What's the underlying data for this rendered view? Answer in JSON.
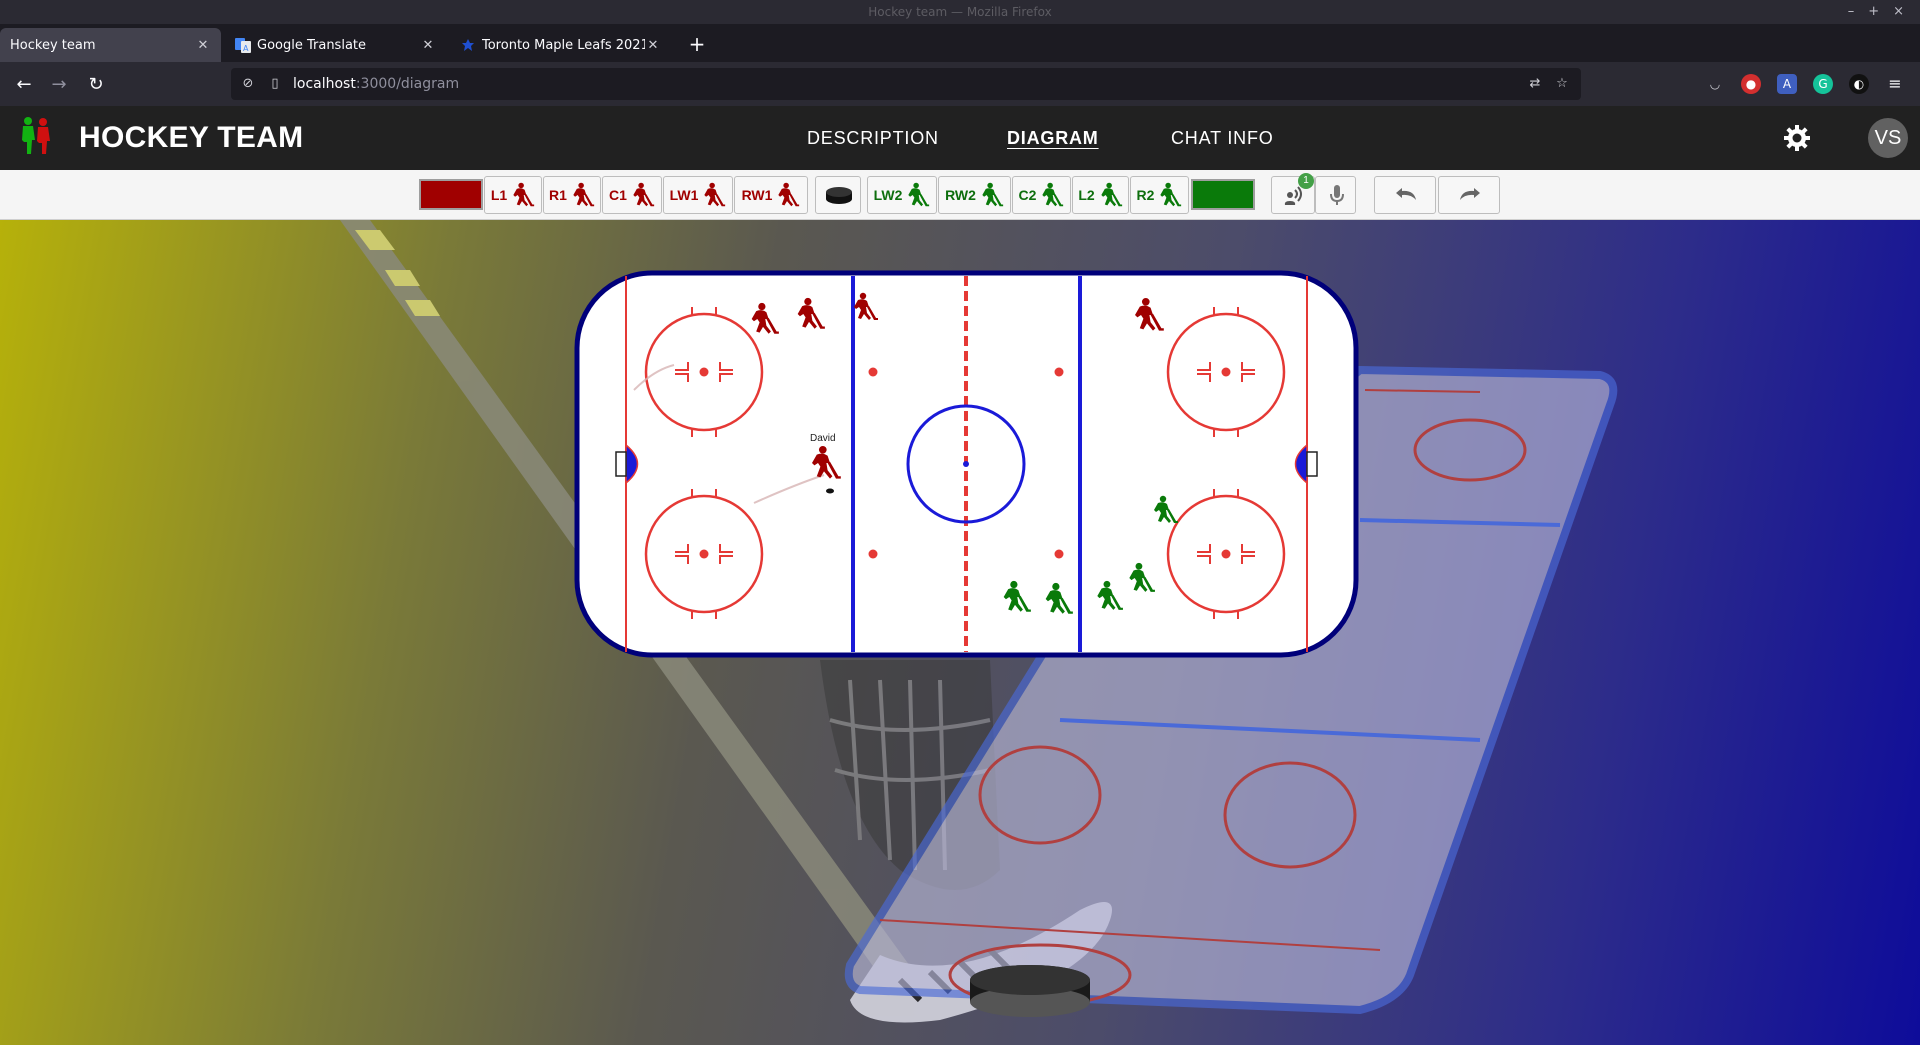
{
  "window": {
    "title": "Hockey team — Mozilla Firefox",
    "controls": [
      "–",
      "+",
      "×"
    ]
  },
  "tabs": [
    {
      "label": "Hockey team",
      "active": true
    },
    {
      "label": "Google Translate",
      "active": false
    },
    {
      "label": "Toronto Maple Leafs 2021 F",
      "active": false
    }
  ],
  "address": {
    "host": "localhost",
    "path": ":3000/diagram"
  },
  "app": {
    "title": "HOCKEY TEAM",
    "menu": [
      {
        "label": "DESCRIPTION"
      },
      {
        "label": "DIAGRAM",
        "active": true
      },
      {
        "label": "CHAT INFO"
      }
    ],
    "avatar_initials": "VS"
  },
  "toolbar": {
    "red_team_color": "#a00000",
    "green_team_color": "#0a7a0a",
    "red_players": [
      "L1",
      "R1",
      "C1",
      "LW1",
      "RW1"
    ],
    "green_players": [
      "LW2",
      "RW2",
      "C2",
      "L2",
      "R2"
    ],
    "voice_badge": "1",
    "icons": [
      "puck-icon",
      "voice-chat-icon",
      "microphone-icon",
      "undo-icon",
      "redo-icon"
    ]
  },
  "rink": {
    "player_name_label": "David"
  }
}
